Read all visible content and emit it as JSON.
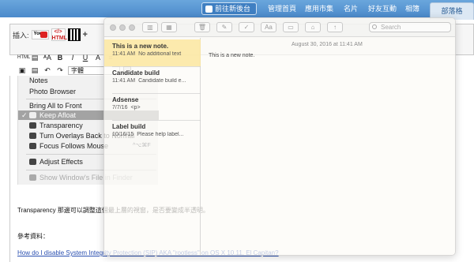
{
  "topnav": {
    "blog_button": "前往新後台",
    "links": [
      "管理首頁",
      "應用市集",
      "名片",
      "好友互動",
      "相簿"
    ],
    "active_tab": "部落格"
  },
  "editor": {
    "insert_label": "插入:",
    "youtube_label": "You",
    "html_icon_label": "</>\nHTML",
    "format_select": "字體"
  },
  "menu_screenshot": {
    "items": [
      {
        "label": "Notes",
        "icon": false,
        "disabled": false,
        "highlight": false,
        "checked": false
      },
      {
        "label": "Photo Browser",
        "icon": false,
        "disabled": false,
        "highlight": false,
        "checked": false
      },
      {
        "label": "Bring All to Front",
        "icon": false,
        "disabled": false,
        "highlight": false,
        "checked": false
      },
      {
        "label": "Keep Afloat",
        "icon": true,
        "disabled": false,
        "highlight": true,
        "checked": true
      },
      {
        "label": "Transparency",
        "icon": true,
        "disabled": false,
        "highlight": false,
        "checked": false
      },
      {
        "label": "Turn Overlays Back to Normal",
        "icon": true,
        "disabled": false,
        "highlight": false,
        "checked": false
      },
      {
        "label": "Focus Follows Mouse",
        "icon": true,
        "disabled": false,
        "highlight": false,
        "checked": false
      },
      {
        "label": "Adjust Effects",
        "icon": true,
        "disabled": false,
        "highlight": false,
        "checked": false
      },
      {
        "label": "Show Window's File in Finder",
        "icon": true,
        "disabled": true,
        "highlight": false,
        "checked": false
      }
    ]
  },
  "post": {
    "transparency_text": "Transparency 那邊可以調整這個最上層的視窗，是否要變成半透明。",
    "reference_label": "參考資料：",
    "reference_link": "How do I disable System Integrity Protection (SIP) AKA \"rootless\" on OS X 10.11, El Capitan?"
  },
  "notes_app": {
    "search_placeholder": "Search",
    "note_date": "August 30, 2016 at 11:41 AM",
    "note_body": "This is a new note.",
    "notes": [
      {
        "title": "This is a new note.",
        "date": "11:41 AM",
        "preview": "No additional text",
        "selected": true
      },
      {
        "title": "Candidate build",
        "date": "11:41 AM",
        "preview": "Candidate build e...",
        "selected": false
      },
      {
        "title": "Adsense",
        "date": "7/7/16",
        "preview": "<p>",
        "selected": false
      },
      {
        "title": "Label build",
        "date": "10/16/15",
        "preview": "Please help label...",
        "selected": false
      }
    ],
    "shortcut_hint": "^⌥⌘F"
  }
}
